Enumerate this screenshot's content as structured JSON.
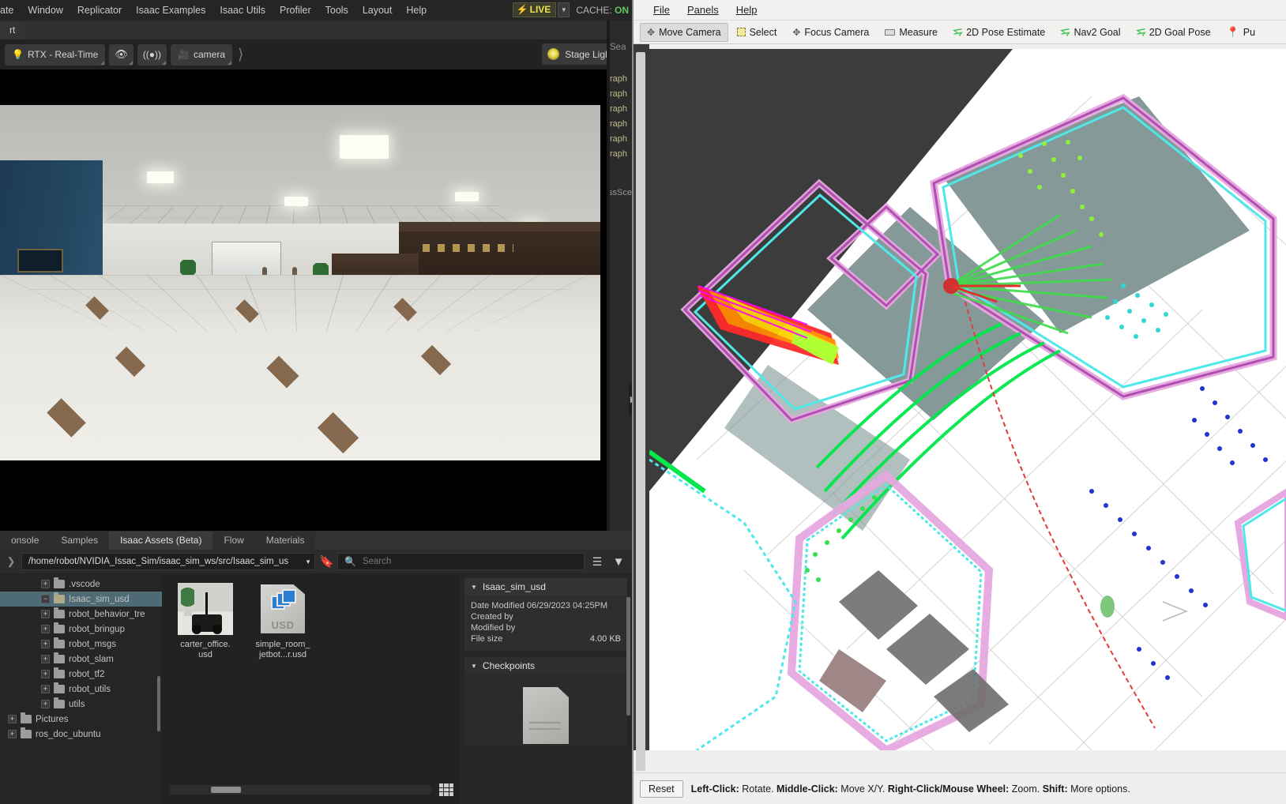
{
  "isaac": {
    "menu": [
      "ate",
      "Window",
      "Replicator",
      "Isaac Examples",
      "Isaac Utils",
      "Profiler",
      "Tools",
      "Layout",
      "Help"
    ],
    "live_label": "LIVE",
    "live_bolt": "bolt-icon",
    "cache_label": "CACHE:",
    "cache_value": "ON",
    "tab_label": "rt",
    "viewport_toolbar": {
      "renderer": "RTX - Real-Time",
      "bulb_icon": "lightbulb-icon",
      "eye_icon": "eye-icon",
      "audio_icon": "audio-icon",
      "camera_icon": "camera-icon",
      "camera_label": "camera",
      "chevron": "double-chevron-right-icon",
      "stage_lights": "Stage Lights"
    },
    "sliver": {
      "search_fragment": "Sea",
      "rows": [
        "raph",
        "raph",
        "raph",
        "raph",
        "raph",
        "raph"
      ],
      "extra": "ssSce"
    },
    "bottom_tabs": [
      {
        "label": "onsole",
        "active": false
      },
      {
        "label": "Samples",
        "active": false
      },
      {
        "label": "Isaac Assets (Beta)",
        "active": true
      },
      {
        "label": "Flow",
        "active": false
      },
      {
        "label": "Materials",
        "active": false
      }
    ],
    "path": "/home/robot/NVIDIA_Issac_Sim/isaac_sim_ws/src/Isaac_sim_us",
    "search_placeholder": "Search",
    "tree": [
      {
        "label": ".vscode",
        "indent": true,
        "expander": "+",
        "selected": false
      },
      {
        "label": "Isaac_sim_usd",
        "indent": true,
        "expander": "−",
        "selected": true
      },
      {
        "label": "robot_behavior_tre",
        "indent": true,
        "expander": "+",
        "selected": false
      },
      {
        "label": "robot_bringup",
        "indent": true,
        "expander": "+",
        "selected": false
      },
      {
        "label": "robot_msgs",
        "indent": true,
        "expander": "+",
        "selected": false
      },
      {
        "label": "robot_slam",
        "indent": true,
        "expander": "+",
        "selected": false
      },
      {
        "label": "robot_tf2",
        "indent": true,
        "expander": "+",
        "selected": false
      },
      {
        "label": "robot_utils",
        "indent": true,
        "expander": "+",
        "selected": false
      },
      {
        "label": "utils",
        "indent": true,
        "expander": "+",
        "selected": false
      },
      {
        "label": "Pictures",
        "indent": false,
        "expander": "+",
        "selected": false
      },
      {
        "label": "ros_doc_ubuntu",
        "indent": false,
        "expander": "+",
        "selected": false
      }
    ],
    "files": [
      {
        "name": "carter_office.\nusd",
        "type": "thumbnail"
      },
      {
        "name": "simple_room_\njetbot...r.usd",
        "type": "usd"
      }
    ],
    "usd_badge": "USD",
    "details": {
      "title": "Isaac_sim_usd",
      "rows": [
        {
          "key": "Date Modified 06/29/2023 04:25PM",
          "value": ""
        },
        {
          "key": "Created by",
          "value": ""
        },
        {
          "key": "Modified by",
          "value": ""
        },
        {
          "key": "File size",
          "value": "4.00 KB"
        }
      ],
      "checkpoints_title": "Checkpoints"
    }
  },
  "rviz": {
    "menu": [
      {
        "label": "File",
        "accel": "F"
      },
      {
        "label": "Panels",
        "accel": "P"
      },
      {
        "label": "Help",
        "accel": "H"
      }
    ],
    "tools": [
      {
        "label": "Move Camera",
        "icon": "move-camera-icon",
        "active": true
      },
      {
        "label": "Select",
        "icon": "select-icon",
        "active": false
      },
      {
        "label": "Focus Camera",
        "icon": "focus-camera-icon",
        "active": false
      },
      {
        "label": "Measure",
        "icon": "measure-icon",
        "active": false
      },
      {
        "label": "2D Pose Estimate",
        "icon": "pose-arrow-icon",
        "active": false
      },
      {
        "label": "Nav2 Goal",
        "icon": "pose-arrow-icon",
        "active": false
      },
      {
        "label": "2D Goal Pose",
        "icon": "pose-arrow-icon",
        "active": false
      },
      {
        "label": "Pu",
        "icon": "publish-point-pin-icon",
        "active": false
      }
    ],
    "status": {
      "reset_label": "Reset",
      "hint_parts": [
        {
          "text": "Left-Click:",
          "bold": true
        },
        {
          "text": " Rotate. ",
          "bold": false
        },
        {
          "text": "Middle-Click:",
          "bold": true
        },
        {
          "text": " Move X/Y. ",
          "bold": false
        },
        {
          "text": "Right-Click/Mouse Wheel:",
          "bold": true
        },
        {
          "text": " Zoom. ",
          "bold": false
        },
        {
          "text": "Shift:",
          "bold": true
        },
        {
          "text": " More options.",
          "bold": false
        }
      ]
    },
    "colors": {
      "costmap_inflation": "#e6a8e0",
      "lidar_scan": "#00ff66",
      "obstacle_cyan": "#4fe8e8",
      "path_red": "#d03030",
      "points_blue": "#2233cc",
      "free_space": "#7f9494"
    }
  }
}
